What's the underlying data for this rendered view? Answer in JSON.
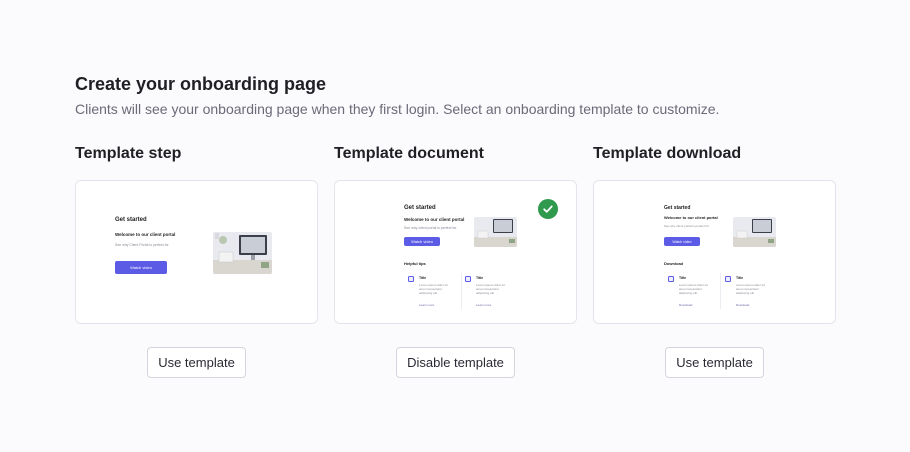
{
  "header": {
    "title": "Create your onboarding page",
    "subtitle": "Clients will see your onboarding page when they first login. Select an onboarding template to customize."
  },
  "templates": [
    {
      "title": "Template step",
      "button_label": "Use template",
      "selected": false,
      "preview": {
        "heading": "Get started",
        "welcome": "Welcome to our client portal",
        "description": "See why Client Portal is perfect for",
        "watch_label": "Watch video"
      }
    },
    {
      "title": "Template document",
      "button_label": "Disable template",
      "selected": true,
      "check_icon": "check-circle-icon",
      "preview": {
        "heading": "Get started",
        "welcome": "Welcome to our client portal",
        "description": "See why client portal is perfect for",
        "watch_label": "Watch video",
        "section": "Helpful tips",
        "tips": [
          {
            "title": "Title",
            "text": "Lorem ipsum dolor sit amet consectetur adipiscing elit",
            "link": "Learn more"
          },
          {
            "title": "Title",
            "text": "Lorem ipsum dolor sit amet consectetur adipiscing elit",
            "link": "Learn more"
          }
        ]
      }
    },
    {
      "title": "Template download",
      "button_label": "Use template",
      "selected": false,
      "preview": {
        "heading": "Get started",
        "welcome": "Welcome to our client portal",
        "description": "See why client portal is perfect for",
        "watch_label": "Watch video",
        "section": "Download",
        "tips": [
          {
            "title": "Title",
            "text": "Lorem ipsum dolor sit amet consectetur adipiscing elit",
            "link": "Download"
          },
          {
            "title": "Title",
            "text": "Lorem ipsum dolor sit amet consectetur adipiscing elit",
            "link": "Download"
          }
        ]
      }
    }
  ],
  "colors": {
    "accent": "#5b5be6",
    "success": "#2f9a4e",
    "background": "#fbfafd"
  }
}
